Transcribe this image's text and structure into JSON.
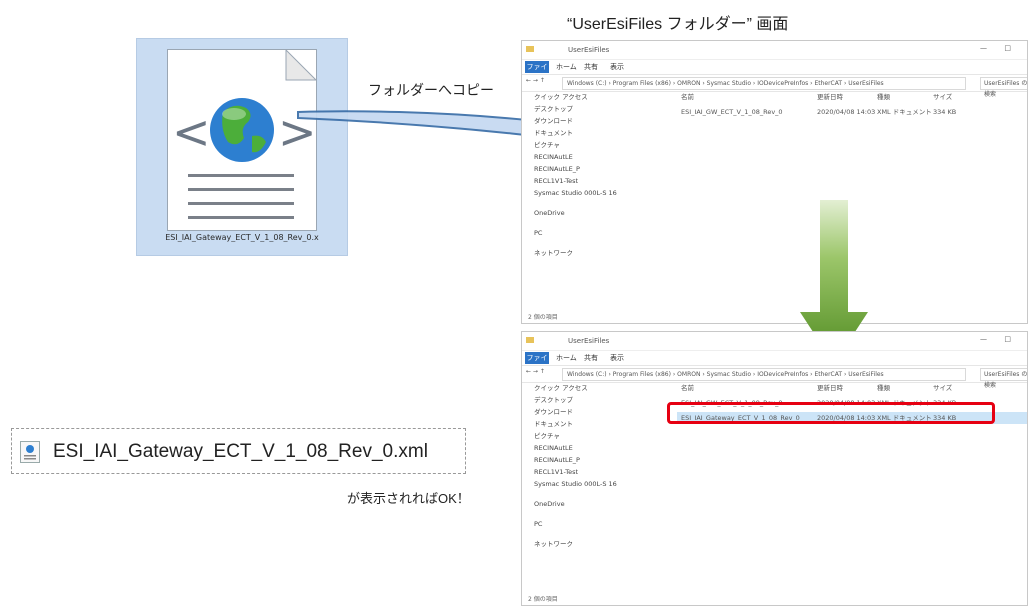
{
  "screen_title": "“UserEsiFiles フォルダー” 画面",
  "copy_label": "フォルダーへコピー",
  "file_icon": {
    "icon": "xml-globe-file-icon",
    "name": "ESI_IAI_Gateway_ECT_V_1_08_Rev_0.x"
  },
  "file_entry": {
    "icon": "xml-file-icon",
    "name": "ESI_IAI_Gateway_ECT_V_1_08_Rev_0.xml"
  },
  "ok_text": "が表示されればOK！",
  "colors": {
    "arrow_blue": "#c5d9f1",
    "arrow_blue_border": "#3a6ea8",
    "arrow_green": "#5e9c2a",
    "highlight_red": "#e60012",
    "tile_bg": "#c9dcf2"
  },
  "explorer": {
    "title": "UserEsiFiles",
    "file_tab": "ファイル",
    "ribbon_tabs": [
      "ホーム",
      "共有",
      "表示"
    ],
    "address": "Windows (C:) › Program Files (x86) › OMRON › Sysmac Studio › IODevicePreInfos › EtherCAT › UserEsiFiles",
    "search_placeholder": "UserEsiFiles の検索",
    "nav_items": [
      "クイック アクセス",
      "デスクトップ",
      "ダウンロード",
      "ドキュメント",
      "ピクチャ",
      "RECINAutLE",
      "RECINAutLE_P",
      "RECL1V1-Test",
      "Sysmac Studio 000L-S 16",
      "OneDrive",
      "PC",
      "ネットワーク"
    ],
    "columns": [
      "名前",
      "更新日時",
      "種類",
      "サイズ"
    ],
    "top_rows": [
      {
        "name": "ESI_IAI_GW_ECT_V_1_08_Rev_0",
        "date": "2020/04/08 14:03",
        "type": "XML ドキュメント",
        "size": "334 KB"
      }
    ],
    "bottom_rows": [
      {
        "name": "ESI_IAI_GW_ECT_V_1_08_Rev_0",
        "date": "2020/04/08 14:03",
        "type": "XML ドキュメント",
        "size": "334 KB"
      },
      {
        "name": "ESI_IAI_Gateway_ECT_V_1_08_Rev_0",
        "date": "2020/04/08 14:03",
        "type": "XML ドキュメント",
        "size": "334 KB"
      }
    ],
    "status": "2 個の項目"
  }
}
